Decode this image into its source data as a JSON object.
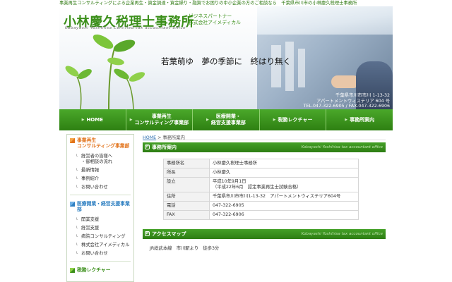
{
  "header": {
    "topline": "事業再生コンサルティングによる企業再生・資金調達・資金繰り・融資でお困りの中小企業の方のご相談なら　千葉県市川市の小林慶久税理士事務所",
    "logo": "小林慶久税理士事務所",
    "logo_en": "Kobayashi Yoshihisa Certified tax accountant office",
    "partner_line1": "ビジネスパートナー",
    "partner_line2": "株式会社アイメディカル",
    "slogan": "若葉萌ゆ　夢の季節に　終はり無く",
    "address_line1": "千葉県市川市市川 1-13-32",
    "address_line2": "アパートメントウィステリア 604 号",
    "address_line3": "TEL.047-322-6905 / FAX.047-322-6906"
  },
  "nav": {
    "items": [
      {
        "label": "HOME"
      },
      {
        "label": "事業再生\nコンサルティング事業部"
      },
      {
        "label": "医療開業・\n経営支援事業部"
      },
      {
        "label": "税務レクチャー"
      },
      {
        "label": "事務所案内"
      }
    ]
  },
  "sidebar": {
    "cat1": {
      "title": "事業再生\nコンサルティング事業部",
      "items": [
        "経営者の皆様へ\n・御相談の流れ",
        "最新情報",
        "事例紹介",
        "お問い合わせ"
      ]
    },
    "cat2": {
      "title": "医療開業・経営支援事業部",
      "items": [
        "開業支援",
        "経営支援",
        "病院コンサルティング",
        "株式会社アイメディカル",
        "お問い合わせ"
      ]
    },
    "cat3": {
      "title": "税務レクチャー"
    }
  },
  "breadcrumb": {
    "home": "HOME",
    "sep": " > ",
    "current": "事務所案内"
  },
  "office": {
    "title": "事務所案内",
    "title_en": "Kobayashi Yoshihisa tax accountant office",
    "rows": [
      {
        "k": "事務所名",
        "v": "小林慶久税理士事務所"
      },
      {
        "k": "所長",
        "v": "小林慶久"
      },
      {
        "k": "設立",
        "v": "平成10年9月1日\n（平成22年6月　認定事業再生士試験合格）"
      },
      {
        "k": "住所",
        "v": "千葉県市川市市川1-13-32　アパートメントウィステリア604号"
      },
      {
        "k": "電話",
        "v": "047-322-6905"
      },
      {
        "k": "FAX",
        "v": "047-322-6906"
      }
    ]
  },
  "access": {
    "title": "アクセスマップ",
    "title_en": "Kobayashi Yoshihisa tax accountant office",
    "text": "JR総武本線　市川駅より　徒歩3分"
  },
  "colors": {
    "brand": "#3b8f1a",
    "nav": "#2e8012",
    "orange": "#e2731b",
    "blue": "#2e7fc1"
  }
}
